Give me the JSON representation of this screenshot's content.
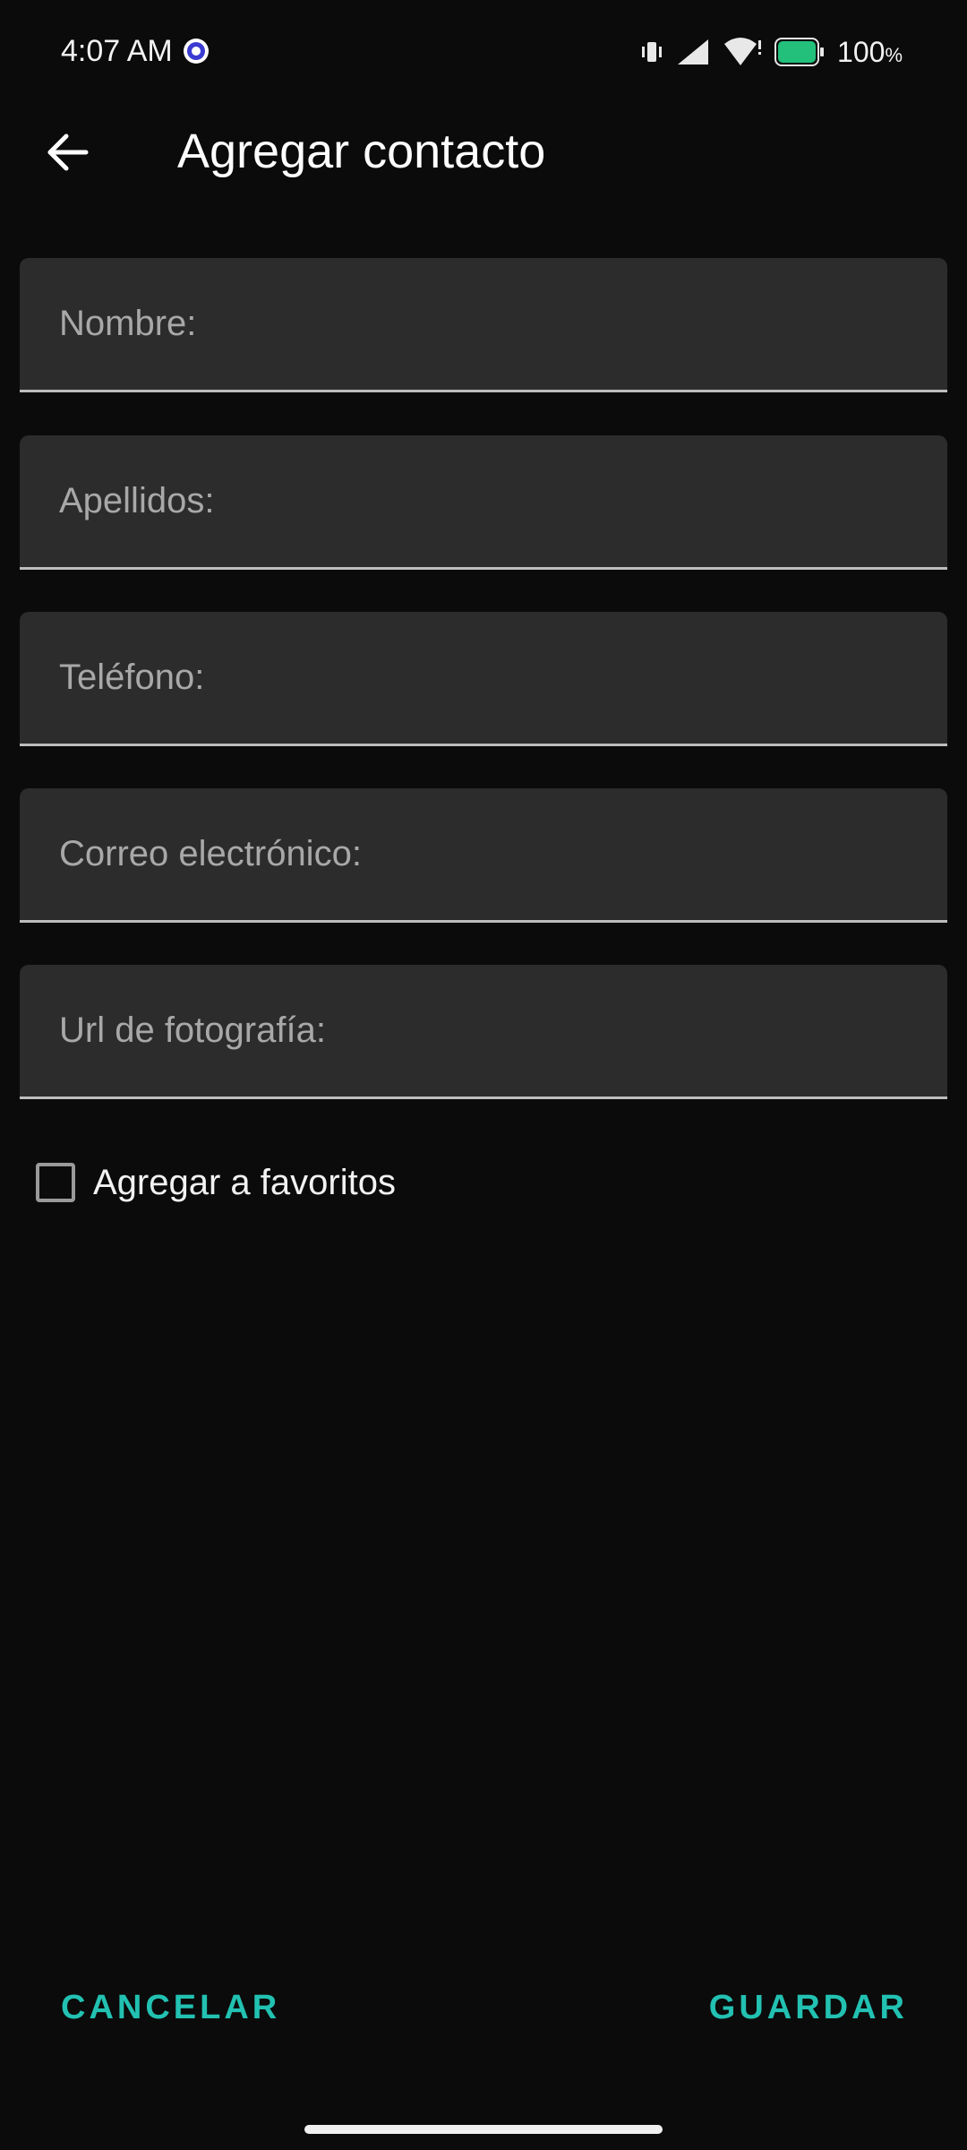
{
  "status_bar": {
    "time": "4:07 AM",
    "battery": "100",
    "battery_unit": "%",
    "icons": [
      "app-notification-icon",
      "vibrate-icon",
      "signal-icon",
      "wifi-icon",
      "battery-icon"
    ]
  },
  "app_bar": {
    "title": "Agregar contacto",
    "back_icon": "arrow-back-icon"
  },
  "form": {
    "fields": [
      {
        "placeholder": "Nombre:",
        "value": ""
      },
      {
        "placeholder": "Apellidos:",
        "value": ""
      },
      {
        "placeholder": "Teléfono:",
        "value": ""
      },
      {
        "placeholder": "Correo electrónico:",
        "value": ""
      },
      {
        "placeholder": "Url de fotografía:",
        "value": ""
      }
    ],
    "favorite": {
      "label": "Agregar a favoritos",
      "checked": false
    }
  },
  "actions": {
    "cancel_label": "CANCELAR",
    "save_label": "GUARDAR"
  },
  "colors": {
    "accent": "#22c1b2",
    "field_bg": "#2c2c2c",
    "background": "#0b0b0b",
    "battery": "#22c07a"
  }
}
